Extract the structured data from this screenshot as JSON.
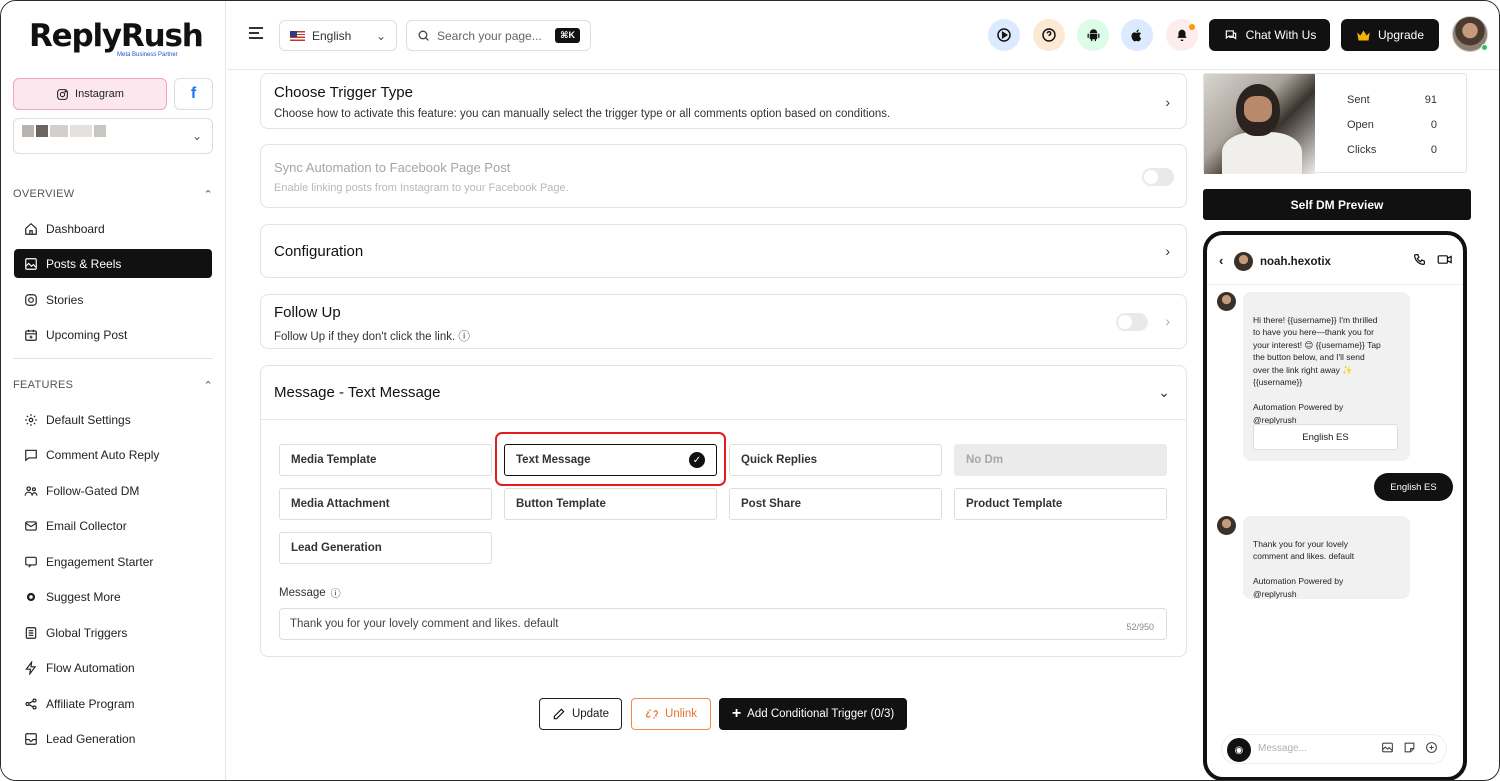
{
  "brand": {
    "logo": "ReplyRush",
    "tagline": "Meta Business Partner"
  },
  "sidebar": {
    "instagram_label": "Instagram",
    "facebook_label": "f",
    "overview_label": "OVERVIEW",
    "features_label": "FEATURES",
    "overview_items": [
      {
        "label": "Dashboard",
        "icon": "home-icon"
      },
      {
        "label": "Posts & Reels",
        "icon": "image-icon",
        "active": true
      },
      {
        "label": "Stories",
        "icon": "instagram-icon"
      },
      {
        "label": "Upcoming Post",
        "icon": "calendar-icon"
      }
    ],
    "feature_items": [
      {
        "label": "Default Settings",
        "icon": "gear-icon"
      },
      {
        "label": "Comment Auto Reply",
        "icon": "comment-icon"
      },
      {
        "label": "Follow-Gated DM",
        "icon": "users-icon"
      },
      {
        "label": "Email Collector",
        "icon": "mail-icon"
      },
      {
        "label": "Engagement Starter",
        "icon": "chat-icon"
      },
      {
        "label": "Suggest More",
        "icon": "cog-icon"
      },
      {
        "label": "Global Triggers",
        "icon": "list-icon"
      },
      {
        "label": "Flow Automation",
        "icon": "bolt-icon"
      },
      {
        "label": "Affiliate Program",
        "icon": "share-icon"
      },
      {
        "label": "Lead Generation",
        "icon": "lead-icon"
      }
    ]
  },
  "topbar": {
    "language": "English",
    "search_placeholder": "Search your page...",
    "shortcut": "⌘K",
    "chat_label": "Chat With Us",
    "upgrade_label": "Upgrade",
    "colors": {
      "play": "#dbeafe",
      "help": "#fde8d4",
      "android": "#dcfce7",
      "apple": "#dbeafe",
      "bell": "#fdecec"
    }
  },
  "main": {
    "trigger": {
      "title": "Choose Trigger Type",
      "subtitle": "Choose how to activate this feature: you can manually select the trigger type or all comments option based on conditions."
    },
    "sync": {
      "title": "Sync Automation to Facebook Page Post",
      "subtitle": "Enable linking posts from Instagram to your Facebook Page."
    },
    "configuration": {
      "title": "Configuration"
    },
    "followup": {
      "title": "Follow Up",
      "subtitle": "Follow Up if they don't click the link."
    },
    "message": {
      "title": "Message - Text Message",
      "options": [
        "Media Template",
        "Text Message",
        "Quick Replies",
        "No Dm",
        "Media Attachment",
        "Button Template",
        "Post Share",
        "Product Template",
        "Lead Generation"
      ],
      "selected": "Text Message",
      "field_label": "Message",
      "field_value": "Thank you for your lovely comment and likes. default",
      "counter": "52/950"
    },
    "actions": {
      "update": "Update",
      "unlink": "Unlink",
      "add_trigger": "Add Conditional Trigger (0/3)"
    }
  },
  "right_panel": {
    "stats": [
      {
        "label": "Sent",
        "value": "91"
      },
      {
        "label": "Open",
        "value": "0"
      },
      {
        "label": "Clicks",
        "value": "0"
      }
    ],
    "preview_label": "Self DM Preview",
    "phone": {
      "username": "noah.hexotix",
      "bubble1": "Hi there! {{username}} I'm thrilled\nto have you here—thank you for\nyour interest! 😊 {{username}} Tap\nthe button below, and I'll send\nover the link right away ✨\n{{username}}\n\nAutomation Powered by\n@replyrush",
      "bubble1_button": "English ES",
      "sent_reply": "English ES",
      "bubble2": "Thank you for your lovely\ncomment and likes. default\n\nAutomation Powered by\n@replyrush",
      "input_placeholder": "Message..."
    }
  }
}
